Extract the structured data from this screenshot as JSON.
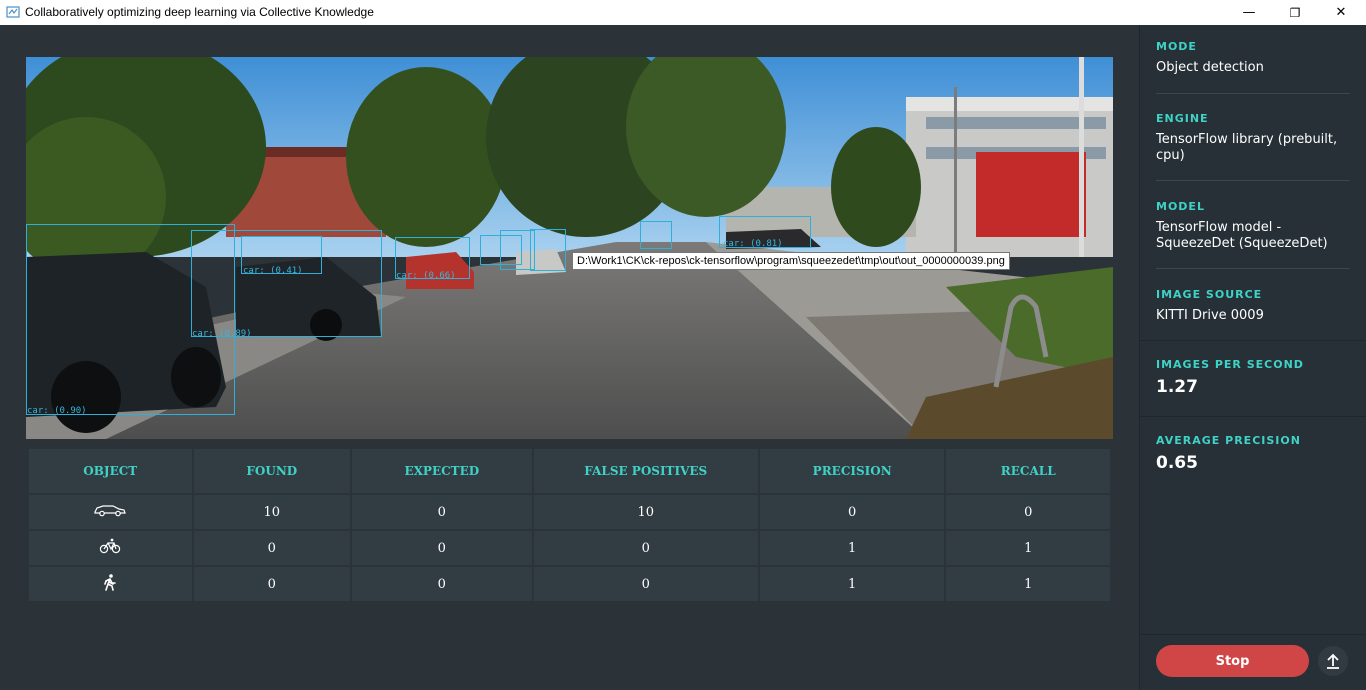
{
  "window": {
    "title": "Collaboratively optimizing deep learning via Collective Knowledge",
    "minimize_glyph": "—",
    "maximize_glyph": "❐",
    "close_glyph": "✕"
  },
  "image": {
    "tooltip": "D:\\Work1\\CK\\ck-repos\\ck-tensorflow\\program\\squeezedet\\tmp\\out\\out_0000000039.png",
    "detection_labels": [
      "car: (0.41)",
      "car: (0.66)",
      "car: (0.89)",
      "car: (0.90)",
      "car: (0.81)"
    ]
  },
  "table": {
    "headers": [
      "OBJECT",
      "FOUND",
      "EXPECTED",
      "FALSE POSITIVES",
      "PRECISION",
      "RECALL"
    ],
    "rows": [
      {
        "icon": "car-icon",
        "found": "10",
        "expected": "0",
        "false_positives": "10",
        "precision": "0",
        "recall": "0"
      },
      {
        "icon": "bicycle-icon",
        "found": "0",
        "expected": "0",
        "false_positives": "0",
        "precision": "1",
        "recall": "1"
      },
      {
        "icon": "pedestrian-icon",
        "found": "0",
        "expected": "0",
        "false_positives": "0",
        "precision": "1",
        "recall": "1"
      }
    ]
  },
  "sidebar": {
    "mode_label": "MODE",
    "mode_value": "Object detection",
    "engine_label": "ENGINE",
    "engine_value": "TensorFlow library (prebuilt, cpu)",
    "model_label": "MODEL",
    "model_value": "TensorFlow model - SqueezeDet (SqueezeDet)",
    "source_label": "IMAGE SOURCE",
    "source_value": "KITTI Drive 0009",
    "ips_label": "IMAGES PER SECOND",
    "ips_value": "1.27",
    "ap_label": "AVERAGE PRECISION",
    "ap_value": "0.65",
    "stop_label": "Stop"
  },
  "colors": {
    "accent": "#3fd2c7",
    "stop": "#d04646",
    "bbox": "#2fb0d8"
  }
}
